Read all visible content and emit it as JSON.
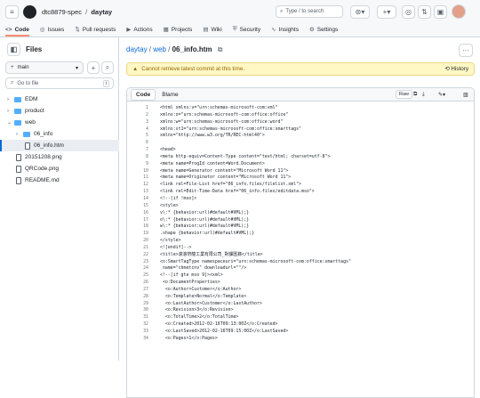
{
  "header": {
    "owner": "dtc8879-spec",
    "sep": "/",
    "repo": "daytay",
    "search_placeholder": "Type / to search"
  },
  "tabs": [
    {
      "label": "Code",
      "icon": "<>"
    },
    {
      "label": "Issues",
      "icon": "◎"
    },
    {
      "label": "Pull requests",
      "icon": "⇅"
    },
    {
      "label": "Actions",
      "icon": "▶"
    },
    {
      "label": "Projects",
      "icon": "▦"
    },
    {
      "label": "Wiki",
      "icon": "▤"
    },
    {
      "label": "Security",
      "icon": "⛨"
    },
    {
      "label": "Insights",
      "icon": "∿"
    },
    {
      "label": "Settings",
      "icon": "⚙"
    }
  ],
  "sidebar": {
    "title": "Files",
    "branch": "main",
    "go_to_file": "Go to file",
    "shortcut": "t",
    "items": [
      {
        "label": "EDM",
        "type": "folder"
      },
      {
        "label": "product",
        "type": "folder"
      },
      {
        "label": "web",
        "type": "folder"
      },
      {
        "label": "06_info",
        "type": "folder"
      },
      {
        "label": "06_info.htm",
        "type": "file"
      },
      {
        "label": "20151208.png",
        "type": "file"
      },
      {
        "label": "QRCode.png",
        "type": "file"
      },
      {
        "label": "README.md",
        "type": "file"
      }
    ]
  },
  "breadcrumb": {
    "repo": "daytay",
    "folder": "web",
    "file": "06_info.htm"
  },
  "warning": {
    "text": "Cannot retrieve latest commit at this time.",
    "history": "History"
  },
  "code": {
    "tab_code": "Code",
    "tab_blame": "Blame",
    "raw": "Raw",
    "lines": [
      "<html xmlns:v=\"urn:schemas-microsoft-com:vml\"",
      "xmlns:o=\"urn:schemas-microsoft-com:office:office\"",
      "xmlns:w=\"urn:schemas-microsoft-com:office:word\"",
      "xmlns:st1=\"urn:schemas-microsoft-com:office:smarttags\"",
      "xmlns=\"http://www.w3.org/TR/REC-html40\">",
      "",
      "<head>",
      "<meta http-equiv=Content-Type content=\"text/html; charset=utf-8\">",
      "<meta name=ProgId content=Word.Document>",
      "<meta name=Generator content=\"Microsoft Word 11\">",
      "<meta name=Originator content=\"Microsoft Word 11\">",
      "<link rel=File-List href=\"06_info.files/filelist.xml\">",
      "<link rel=Edit-Time-Data href=\"06_info.files/editdata.mso\">",
      "<!--[if !mso]>",
      "<style>",
      "v\\:* {behavior:url(#default#VML);}",
      "o\\:* {behavior:url(#default#VML);}",
      "w\\:* {behavior:url(#default#VML);}",
      ".shape {behavior:url(#default#VML);}",
      "</style>",
      "<![endif]-->",
      "<title>滚滚帶龍工業有限公司_對課匯錄</title>",
      "<o:SmartTagType namespaceuri=\"urn:schemas-microsoft-com:office:smarttags\"",
      " name=\"chmetcnv\" downloadurl=\"\"/>",
      "<!--[if gte mso 9]><xml>",
      " <o:DocumentProperties>",
      "  <o:Author>Customer</o:Author>",
      "  <o:Template>Normal</o:Template>",
      "  <o:LastAuthor>Customer</o:LastAuthor>",
      "  <o:Revision>3</o:Revision>",
      "  <o:TotalTime>2</o:TotalTime>",
      "  <o:Created>2012-02-16T09:13:00Z</o:Created>",
      "  <o:LastSaved>2012-02-16T09:15:00Z</o:LastSaved>",
      "  <o:Pages>1</o:Pages>"
    ]
  }
}
